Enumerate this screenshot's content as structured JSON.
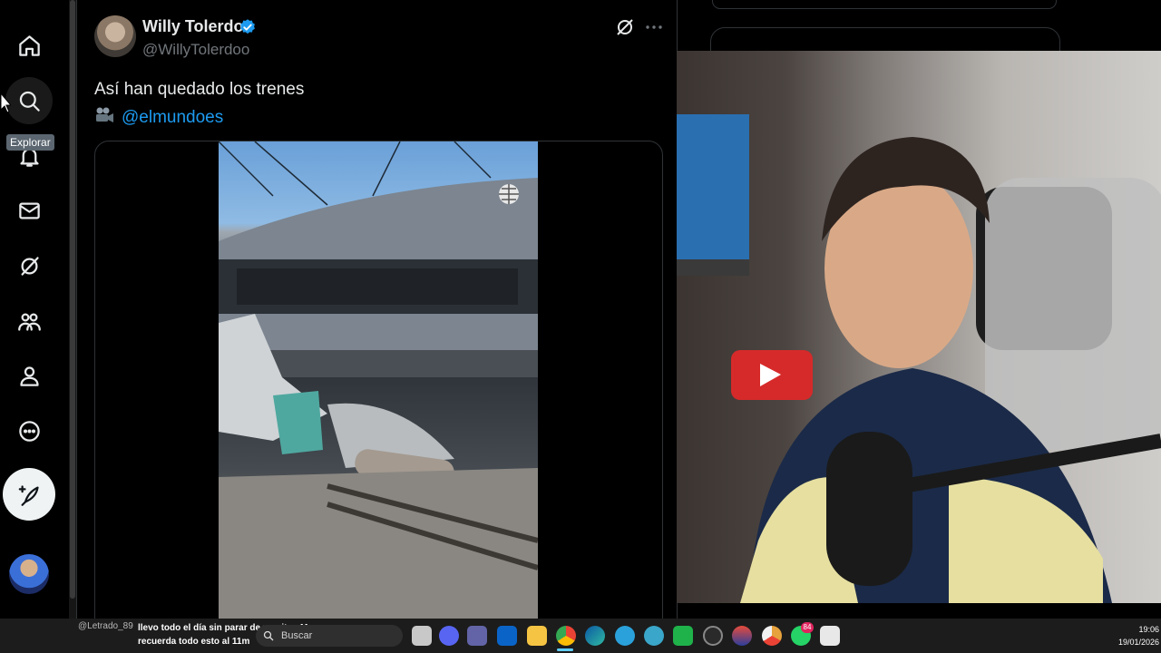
{
  "nav": {
    "tooltip": "Explorar"
  },
  "tweet": {
    "author_name": "Willy Tolerdo",
    "author_handle": "@WillyTolerdoo",
    "text": "Así han quedado los trenes",
    "mention": "@elmundoes"
  },
  "taskbar": {
    "chat_user": "@Letrado_89",
    "chat_message": "llevo todo el día sin parar de vomitar. Me recuerda todo esto al 11m",
    "search_placeholder": "Buscar",
    "whatsapp_badge": "84",
    "clock_time": "19:06",
    "clock_date": "19/01/2026"
  },
  "colors": {
    "accent": "#1d9bf0",
    "background": "#000000",
    "text": "#e7e9ea",
    "muted": "#71767b"
  },
  "icons": {
    "nav": [
      "home-icon",
      "search-icon",
      "notifications-icon",
      "messages-icon",
      "grok-icon",
      "communities-icon",
      "profile-icon",
      "more-icon",
      "compose-icon"
    ],
    "taskbar": [
      "start-icon",
      "search-icon",
      "task-view-icon",
      "discord-icon",
      "teams-icon",
      "outlook-icon",
      "file-explorer-icon",
      "chrome-icon",
      "edge-icon",
      "telegram-icon",
      "browser-icon",
      "camtasia-icon",
      "obs-icon",
      "app-icon",
      "chrome-canary-icon",
      "whatsapp-icon",
      "snipping-tool-icon"
    ]
  }
}
